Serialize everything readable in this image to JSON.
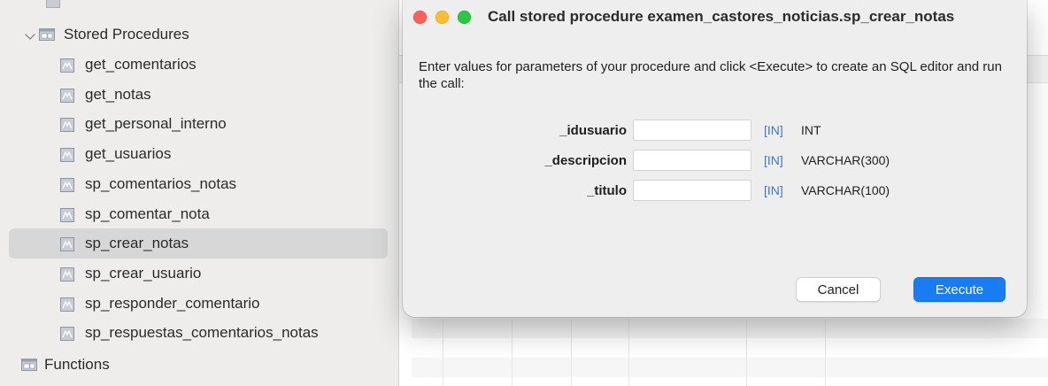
{
  "sidebar": {
    "stored_procedures_label": "Stored Procedures",
    "functions_label": "Functions",
    "procedures": [
      "get_comentarios",
      "get_notas",
      "get_personal_interno",
      "get_usuarios",
      "sp_comentarios_notas",
      "sp_comentar_nota",
      "sp_crear_notas",
      "sp_crear_usuario",
      "sp_responder_comentario",
      "sp_respuestas_comentarios_notas"
    ],
    "selected": "sp_crear_notas"
  },
  "dialog": {
    "title": "Call stored procedure examen_castores_noticias.sp_crear_notas",
    "instructions": "Enter values for parameters of your procedure and click <Execute> to create an SQL editor and run the call:",
    "params": [
      {
        "name": "_idusuario",
        "value": "",
        "mode": "[IN]",
        "type": "INT"
      },
      {
        "name": "_descripcion",
        "value": "",
        "mode": "[IN]",
        "type": "VARCHAR(300)"
      },
      {
        "name": "_titulo",
        "value": "",
        "mode": "[IN]",
        "type": "VARCHAR(100)"
      }
    ],
    "cancel_label": "Cancel",
    "execute_label": "Execute"
  },
  "colors": {
    "accent": "#1a7cf3",
    "mode_text": "#3b78c9",
    "selection": "#d7d7d7"
  }
}
